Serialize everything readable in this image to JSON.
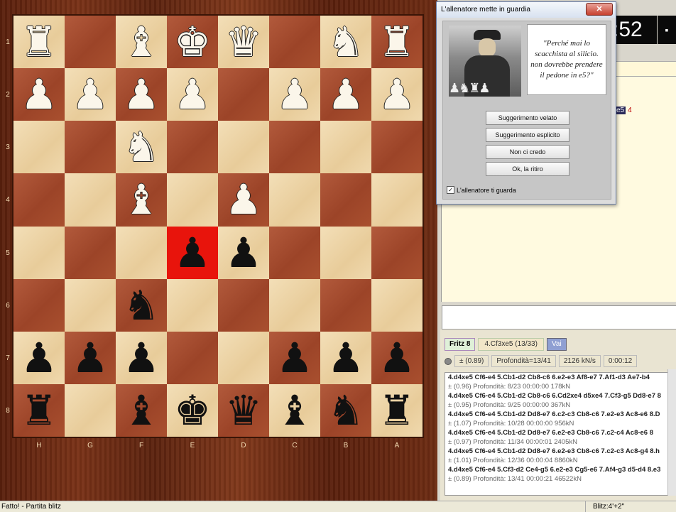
{
  "board": {
    "rank_labels": [
      "1",
      "2",
      "3",
      "4",
      "5",
      "6",
      "7",
      "8"
    ],
    "file_labels": [
      "H",
      "G",
      "F",
      "E",
      "D",
      "C",
      "B",
      "A"
    ],
    "highlight_square": "e5",
    "rows": [
      [
        {
          "p": "♜",
          "c": "white",
          "n": "white-rook"
        },
        {
          "p": "",
          "c": "",
          "n": ""
        },
        {
          "p": "♝",
          "c": "white",
          "n": "white-bishop"
        },
        {
          "p": "♚",
          "c": "white",
          "n": "white-king"
        },
        {
          "p": "♛",
          "c": "white",
          "n": "white-queen"
        },
        {
          "p": "",
          "c": "",
          "n": ""
        },
        {
          "p": "♞",
          "c": "white",
          "n": "white-knight"
        },
        {
          "p": "♜",
          "c": "white",
          "n": "white-rook"
        }
      ],
      [
        {
          "p": "♟",
          "c": "white",
          "n": "white-pawn"
        },
        {
          "p": "♟",
          "c": "white",
          "n": "white-pawn"
        },
        {
          "p": "♟",
          "c": "white",
          "n": "white-pawn"
        },
        {
          "p": "♟",
          "c": "white",
          "n": "white-pawn"
        },
        {
          "p": "",
          "c": "",
          "n": ""
        },
        {
          "p": "♟",
          "c": "white",
          "n": "white-pawn"
        },
        {
          "p": "♟",
          "c": "white",
          "n": "white-pawn"
        },
        {
          "p": "♟",
          "c": "white",
          "n": "white-pawn"
        }
      ],
      [
        {
          "p": "",
          "c": "",
          "n": ""
        },
        {
          "p": "",
          "c": "",
          "n": ""
        },
        {
          "p": "♞",
          "c": "white",
          "n": "white-knight"
        },
        {
          "p": "",
          "c": "",
          "n": ""
        },
        {
          "p": "",
          "c": "",
          "n": ""
        },
        {
          "p": "",
          "c": "",
          "n": ""
        },
        {
          "p": "",
          "c": "",
          "n": ""
        },
        {
          "p": "",
          "c": "",
          "n": ""
        }
      ],
      [
        {
          "p": "",
          "c": "",
          "n": ""
        },
        {
          "p": "",
          "c": "",
          "n": ""
        },
        {
          "p": "♝",
          "c": "white",
          "n": "white-bishop"
        },
        {
          "p": "",
          "c": "",
          "n": ""
        },
        {
          "p": "♟",
          "c": "white",
          "n": "white-pawn"
        },
        {
          "p": "",
          "c": "",
          "n": ""
        },
        {
          "p": "",
          "c": "",
          "n": ""
        },
        {
          "p": "",
          "c": "",
          "n": ""
        }
      ],
      [
        {
          "p": "",
          "c": "",
          "n": ""
        },
        {
          "p": "",
          "c": "",
          "n": ""
        },
        {
          "p": "",
          "c": "",
          "n": ""
        },
        {
          "p": "♟",
          "c": "black",
          "n": "black-pawn"
        },
        {
          "p": "♟",
          "c": "black",
          "n": "black-pawn"
        },
        {
          "p": "",
          "c": "",
          "n": ""
        },
        {
          "p": "",
          "c": "",
          "n": ""
        },
        {
          "p": "",
          "c": "",
          "n": ""
        }
      ],
      [
        {
          "p": "",
          "c": "",
          "n": ""
        },
        {
          "p": "",
          "c": "",
          "n": ""
        },
        {
          "p": "♞",
          "c": "black",
          "n": "black-knight"
        },
        {
          "p": "",
          "c": "",
          "n": ""
        },
        {
          "p": "",
          "c": "",
          "n": ""
        },
        {
          "p": "",
          "c": "",
          "n": ""
        },
        {
          "p": "",
          "c": "",
          "n": ""
        },
        {
          "p": "",
          "c": "",
          "n": ""
        }
      ],
      [
        {
          "p": "♟",
          "c": "black",
          "n": "black-pawn"
        },
        {
          "p": "♟",
          "c": "black",
          "n": "black-pawn"
        },
        {
          "p": "♟",
          "c": "black",
          "n": "black-pawn"
        },
        {
          "p": "",
          "c": "",
          "n": ""
        },
        {
          "p": "",
          "c": "",
          "n": ""
        },
        {
          "p": "♟",
          "c": "black",
          "n": "black-pawn"
        },
        {
          "p": "♟",
          "c": "black",
          "n": "black-pawn"
        },
        {
          "p": "♟",
          "c": "black",
          "n": "black-pawn"
        }
      ],
      [
        {
          "p": "♜",
          "c": "black",
          "n": "black-rook"
        },
        {
          "p": "",
          "c": "",
          "n": ""
        },
        {
          "p": "♝",
          "c": "black",
          "n": "black-bishop"
        },
        {
          "p": "♚",
          "c": "black",
          "n": "black-king"
        },
        {
          "p": "♛",
          "c": "black",
          "n": "black-queen"
        },
        {
          "p": "♝",
          "c": "black",
          "n": "black-bishop"
        },
        {
          "p": "♞",
          "c": "black",
          "n": "black-knight"
        },
        {
          "p": "♜",
          "c": "black",
          "n": "black-rook"
        }
      ]
    ]
  },
  "clock": {
    "time": ":52",
    "side": "▪"
  },
  "move_chip": {
    "move": "e5",
    "num": "4"
  },
  "dialog": {
    "title": "L'allenatore mette in guardia",
    "close": "✕",
    "quote": "\"Perché mai lo scacchista al silicio. non dovrebbe prendere il pedone in e5?\"",
    "photo_pieces": "♟♞♜♟",
    "buttons": [
      "Suggerimento velato",
      "Suggerimento esplicito",
      "Non ci credo",
      "Ok, la ritiro"
    ],
    "checkbox_label": "L'allenatore ti guarda",
    "checkbox_mark": "✓"
  },
  "engine": {
    "name": "Fritz 8",
    "move": "4.Cf3xe5  (13/33)",
    "button": "Vai",
    "eval": "±  (0.89)",
    "depth": "Profondità=13/41",
    "speed": "2126 kN/s",
    "time": "0:00:12",
    "lines": [
      {
        "main": "4.d4xe5 Cf6-e4 5.Cb1-d2 Cb8-c6 6.e2-e3 Af8-e7 7.Af1-d3 Ae7-b4",
        "sub": "±  (0.96)  Profondità: 8/23  00:00:00  178kN"
      },
      {
        "main": "4.d4xe5 Cf6-e4 5.Cb1-d2 Cb8-c6 6.Cd2xe4 d5xe4 7.Cf3-g5 Dd8-e7 8",
        "sub": "±  (0.95)  Profondità: 9/25  00:00:00  367kN"
      },
      {
        "main": "4.d4xe5 Cf6-e4 5.Cb1-d2 Dd8-e7 6.c2-c3 Cb8-c6 7.e2-e3 Ac8-e6 8.D",
        "sub": "±  (1.07)  Profondità: 10/28  00:00:00  956kN"
      },
      {
        "main": "4.d4xe5 Cf6-e4 5.Cb1-d2 Dd8-e7 6.e2-e3 Cb8-c6 7.c2-c4 Ac8-e6 8",
        "sub": "±  (0.97)  Profondità: 11/34  00:00:01  2405kN"
      },
      {
        "main": "4.d4xe5 Cf6-e4 5.Cb1-d2 Dd8-e7 6.e2-e3 Cb8-c6 7.c2-c3 Ac8-g4 8.h",
        "sub": "±  (1.01)  Profondità: 12/36  00:00:04  8860kN"
      },
      {
        "main": "4.d4xe5 Cf6-e4 5.Cf3-d2 Ce4-g5 6.e2-e3 Cg5-e6 7.Af4-g3 d5-d4 8.e3",
        "sub": "±  (0.89)  Profondità: 13/41  00:00:21  46522kN"
      }
    ]
  },
  "status": {
    "text": "Fatto! - Partita blitz",
    "blitz": "Blitz:4'+2\""
  }
}
